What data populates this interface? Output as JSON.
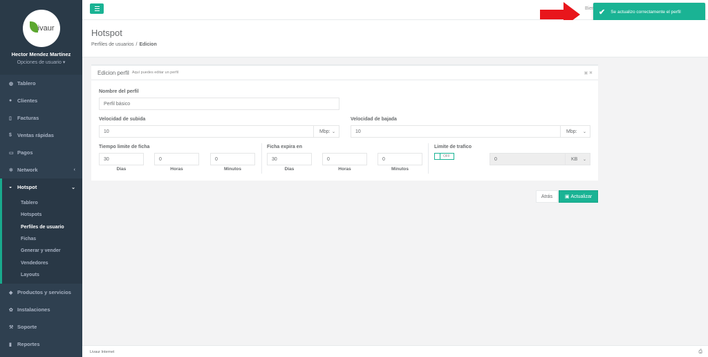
{
  "sidebar": {
    "logo_text": "Livaur",
    "user_name": "Hector Mendez Martínez",
    "user_options": "Opciones de usuario",
    "items": [
      {
        "label": "Tablero",
        "icon": "dashboard-icon"
      },
      {
        "label": "Clientes",
        "icon": "users-icon"
      },
      {
        "label": "Facturas",
        "icon": "file-icon"
      },
      {
        "label": "Ventas rápidas",
        "icon": "dollar-icon"
      },
      {
        "label": "Pagos",
        "icon": "money-icon"
      },
      {
        "label": "Network",
        "icon": "network-icon"
      },
      {
        "label": "Hotspot",
        "icon": "wifi-icon"
      },
      {
        "label": "Productos y servicios",
        "icon": "tag-icon"
      },
      {
        "label": "Instalaciones",
        "icon": "gears-icon"
      },
      {
        "label": "Soporte",
        "icon": "wrench-icon"
      },
      {
        "label": "Reportes",
        "icon": "book-icon"
      }
    ],
    "hotspot_sub": [
      "Tablero",
      "Hotspots",
      "Perfiles de usuario",
      "Fichas",
      "Generar y vender",
      "Vendedores",
      "Layouts"
    ]
  },
  "topbar": {
    "welcome": "Bien"
  },
  "toast": {
    "message": "Se actualizo correctamente el perfil"
  },
  "heading": {
    "title": "Hotspot",
    "breadcrumb_parent": "Perfiles de usuarios",
    "breadcrumb_current": "Edicion"
  },
  "panel": {
    "title": "Edicion perfil",
    "subtitle": "Aquí puedes editar un perfil",
    "profile_name_label": "Nombre del perfil",
    "profile_name_value": "Perfil básico",
    "upload_label": "Velocidad de subida",
    "upload_value": "10",
    "upload_unit": "Mbp:",
    "download_label": "Velocidad de bajada",
    "download_value": "10",
    "download_unit": "Mbp:",
    "time_limit_label": "Tiempo limite de ficha",
    "time_limit": {
      "days": "30",
      "hours": "0",
      "minutes": "0"
    },
    "expires_label": "Ficha expira en",
    "expires": {
      "days": "30",
      "hours": "0",
      "minutes": "0"
    },
    "days_label": "Dias",
    "hours_label": "Horas",
    "minutes_label": "Minutos",
    "traffic_label": "Limite de trafico",
    "toggle_off": "OFF",
    "traffic_value": "0",
    "traffic_unit": "KB"
  },
  "actions": {
    "back": "Atrás",
    "update": "Actualizar"
  },
  "footer": {
    "text": "Livaur Internet"
  },
  "colors": {
    "sidebar": "#2f4050",
    "accent": "#1ab394",
    "arrow": "#e8161c"
  }
}
